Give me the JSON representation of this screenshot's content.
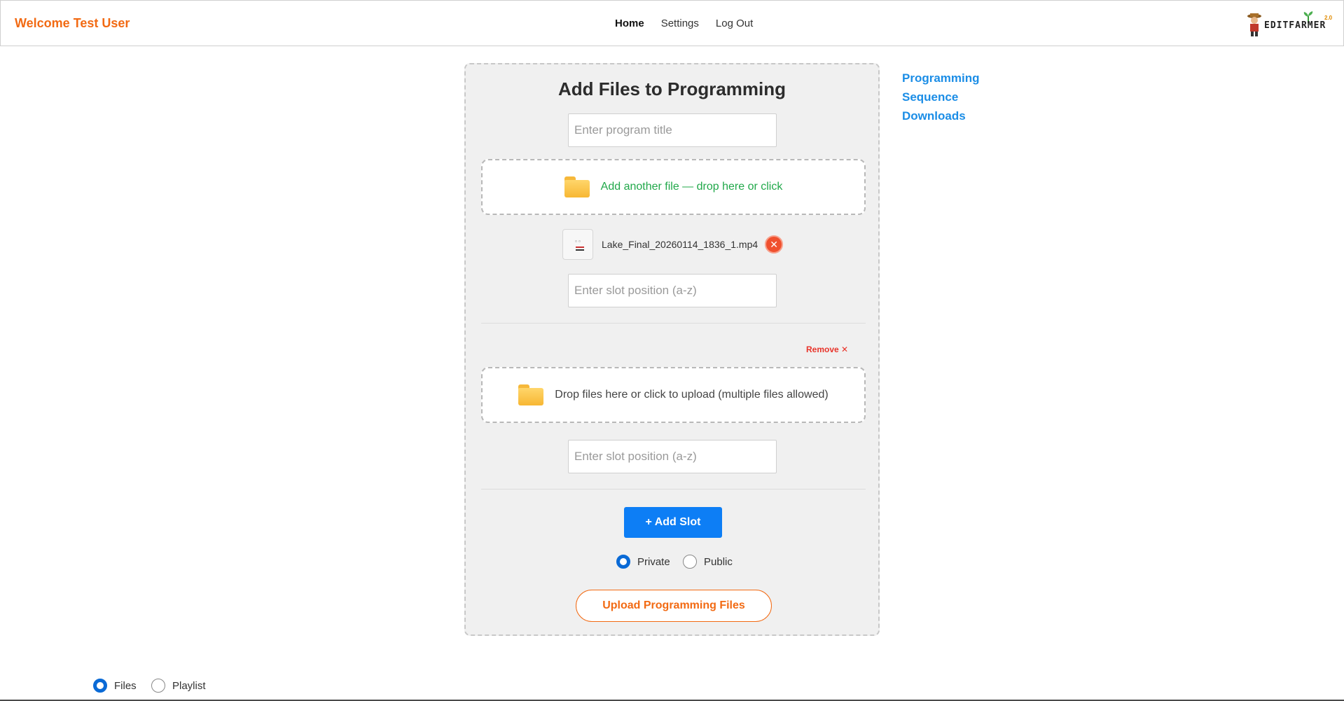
{
  "header": {
    "welcome": "Welcome Test User",
    "nav": [
      "Home",
      "Settings",
      "Log Out"
    ],
    "active_nav": "Home",
    "logo_text": "EDITFARMER",
    "logo_version": "2.0"
  },
  "card": {
    "title": "Add Files to Programming",
    "program_title_placeholder": "Enter program title",
    "slots": [
      {
        "dropzone_text": "Add another file — drop here or click",
        "file_name": "Lake_Final_20260114_1836_1.mp4",
        "remove_file_glyph": "✕",
        "slot_placeholder": "Enter slot position (a-z)"
      },
      {
        "remove_label": "Remove ✕",
        "dropzone_text": "Drop files here or click to upload (multiple files allowed)",
        "slot_placeholder": "Enter slot position (a-z)"
      }
    ],
    "add_slot_label": "+ Add Slot",
    "visibility": {
      "options": [
        "Private",
        "Public"
      ],
      "selected": "Private"
    },
    "upload_label": "Upload Programming Files"
  },
  "side_links": [
    "Programming",
    "Sequence",
    "Downloads"
  ],
  "view_toggle": {
    "options": [
      "Files",
      "Playlist"
    ],
    "selected": "Files"
  },
  "colors": {
    "accent_orange": "#f26a13",
    "link_blue": "#1b8de6",
    "button_blue": "#0d7ef5",
    "success_green": "#21a84a",
    "danger_red": "#e8342a"
  }
}
